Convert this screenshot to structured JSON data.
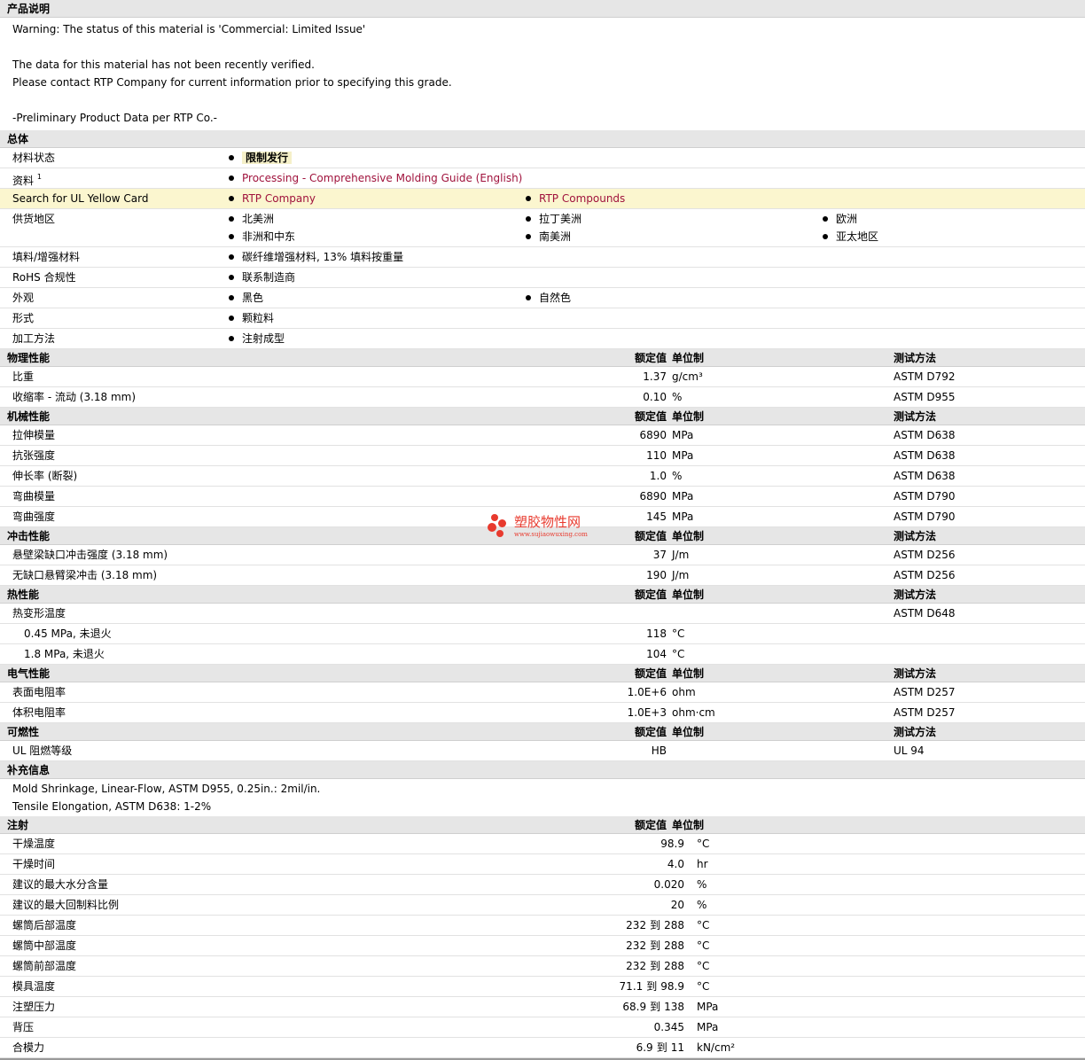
{
  "desc": {
    "title": "产品说明",
    "lines": [
      "Warning: The status of this material is 'Commercial: Limited Issue'",
      "",
      "The data for this material has not been recently verified.",
      "Please contact RTP Company for current information prior to specifying this grade.",
      "",
      "-Preliminary Product Data per RTP Co.-"
    ]
  },
  "general": {
    "title": "总体",
    "status_label": "材料状态",
    "status_value": "限制发行",
    "docs_label": "资料",
    "docs_sup": "1",
    "docs_link": "Processing - Comprehensive Molding Guide (English)",
    "ul_label": "Search for UL Yellow Card",
    "ul_link1": "RTP Company",
    "ul_link2": "RTP Compounds",
    "region_label": "供货地区",
    "regions": [
      "北美洲",
      "拉丁美洲",
      "欧洲",
      "非洲和中东",
      "南美洲",
      "亚太地区"
    ],
    "filler_label": "填料/增强材料",
    "filler_value": "碳纤维增强材料, 13% 填料按重量",
    "rohs_label": "RoHS 合规性",
    "rohs_value": "联系制造商",
    "appearance_label": "外观",
    "appearance": [
      "黑色",
      "自然色"
    ],
    "form_label": "形式",
    "form_value": "颗粒料",
    "method_label": "加工方法",
    "method_value": "注射成型"
  },
  "headers": {
    "nominal": "额定值",
    "unit": "单位制",
    "test": "测试方法"
  },
  "physical": {
    "title": "物理性能",
    "rows": [
      {
        "label": "比重",
        "value": "1.37",
        "unit": "g/cm³",
        "test": "ASTM D792"
      },
      {
        "label": "收缩率  - 流动  (3.18 mm)",
        "value": "0.10",
        "unit": "%",
        "test": "ASTM D955"
      }
    ]
  },
  "mechanical": {
    "title": "机械性能",
    "rows": [
      {
        "label": "拉伸模量",
        "value": "6890",
        "unit": "MPa",
        "test": "ASTM D638"
      },
      {
        "label": "抗张强度",
        "value": "110",
        "unit": "MPa",
        "test": "ASTM D638"
      },
      {
        "label": "伸长率  (断裂)",
        "value": "1.0",
        "unit": "%",
        "test": "ASTM D638"
      },
      {
        "label": "弯曲模量",
        "value": "6890",
        "unit": "MPa",
        "test": "ASTM D790"
      },
      {
        "label": "弯曲强度",
        "value": "145",
        "unit": "MPa",
        "test": "ASTM D790"
      }
    ]
  },
  "impact": {
    "title": "冲击性能",
    "rows": [
      {
        "label": "悬壁梁缺口冲击强度  (3.18 mm)",
        "value": "37",
        "unit": "J/m",
        "test": "ASTM D256"
      },
      {
        "label": "无缺口悬臂梁冲击  (3.18 mm)",
        "value": "190",
        "unit": "J/m",
        "test": "ASTM D256"
      }
    ]
  },
  "thermal": {
    "title": "热性能",
    "hdt_label": "热变形温度",
    "hdt_test": "ASTM D648",
    "rows": [
      {
        "label": "0.45 MPa, 未退火",
        "value": "118",
        "unit": "°C"
      },
      {
        "label": "1.8 MPa, 未退火",
        "value": "104",
        "unit": "°C"
      }
    ]
  },
  "electrical": {
    "title": "电气性能",
    "rows": [
      {
        "label": "表面电阻率",
        "value": "1.0E+6",
        "unit": "ohm",
        "test": "ASTM D257"
      },
      {
        "label": "体积电阻率",
        "value": "1.0E+3",
        "unit": "ohm·cm",
        "test": "ASTM D257"
      }
    ]
  },
  "flammability": {
    "title": "可燃性",
    "rows": [
      {
        "label": "UL 阻燃等级",
        "value": "HB",
        "unit": "",
        "test": "UL 94"
      }
    ]
  },
  "supplement": {
    "title": "补充信息",
    "lines": [
      "Mold Shrinkage, Linear-Flow, ASTM D955, 0.25in.: 2mil/in.",
      "Tensile Elongation, ASTM D638: 1-2%"
    ]
  },
  "injection": {
    "title": "注射",
    "rows": [
      {
        "label": "干燥温度",
        "value": "98.9",
        "unit": "°C"
      },
      {
        "label": "干燥时间",
        "value": "4.0",
        "unit": "hr"
      },
      {
        "label": "建议的最大水分含量",
        "value": "0.020",
        "unit": "%"
      },
      {
        "label": "建议的最大回制料比例",
        "value": "20",
        "unit": "%"
      }
    ],
    "range_rows": [
      {
        "label": "螺筒后部温度",
        "lo": "232",
        "to": "到",
        "hi": "288",
        "unit": "°C"
      },
      {
        "label": "螺筒中部温度",
        "lo": "232",
        "to": "到",
        "hi": "288",
        "unit": "°C"
      },
      {
        "label": "螺筒前部温度",
        "lo": "232",
        "to": "到",
        "hi": "288",
        "unit": "°C"
      },
      {
        "label": "模具温度",
        "lo": "71.1",
        "to": "到",
        "hi": "98.9",
        "unit": "°C"
      },
      {
        "label": "注塑压力",
        "lo": "68.9",
        "to": "到",
        "hi": "138",
        "unit": "MPa"
      }
    ],
    "back_label": "背压",
    "back_value": "0.345",
    "back_unit": "MPa",
    "clamp_label": "合模力",
    "clamp_lo": "6.9",
    "clamp_to": "到",
    "clamp_hi": "11",
    "clamp_unit": "kN/cm²"
  },
  "watermark": {
    "text": "塑胶物性网",
    "url": "www.sujiaowuxing.com"
  }
}
